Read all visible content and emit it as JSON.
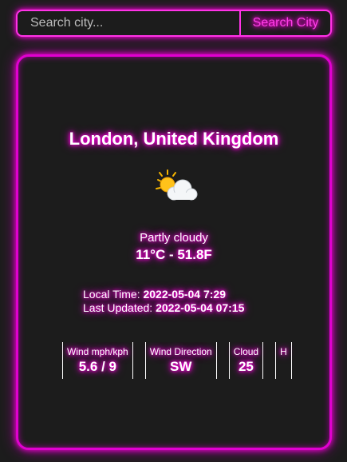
{
  "search": {
    "placeholder": "Search city...",
    "value": "",
    "button_label": "Search City"
  },
  "weather": {
    "location": "London, United Kingdom",
    "icon": "partly-cloudy-icon",
    "condition": "Partly cloudy",
    "temperature": "11°C - 51.8F",
    "local_time_label": "Local Time: ",
    "local_time": "2022-05-04 7:29",
    "last_updated_label": "Last Updated: ",
    "last_updated": "2022-05-04 07:15",
    "stats": [
      {
        "label": "Wind mph/kph",
        "value": "5.6 / 9"
      },
      {
        "label": "Wind Direction",
        "value": "SW"
      },
      {
        "label": "Cloud",
        "value": "25"
      },
      {
        "label": "H",
        "value": ""
      }
    ]
  },
  "colors": {
    "neon": "#ff00dd",
    "background": "#1c1c1c",
    "text": "#ffffff"
  }
}
